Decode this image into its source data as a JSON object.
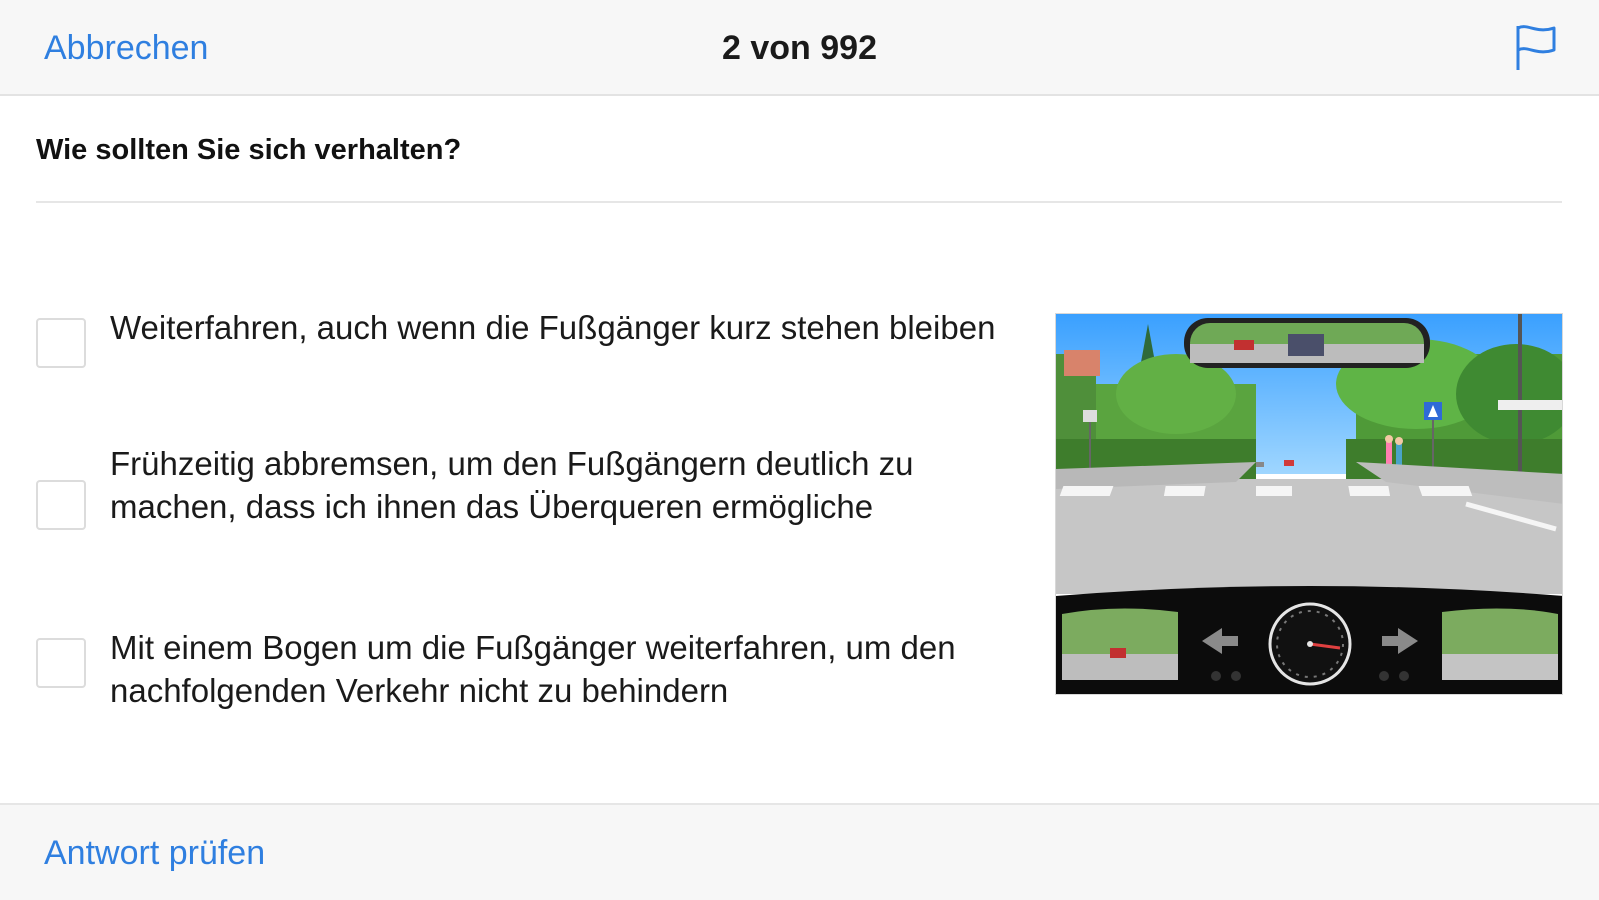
{
  "header": {
    "cancel_label": "Abbrechen",
    "counter": "2 von 992",
    "flag_icon": "flag-icon"
  },
  "question": {
    "text": "Wie sollten Sie sich verhalten?"
  },
  "options": [
    {
      "text": "Weiterfahren, auch wenn die Fußgänger kurz stehen bleiben",
      "checked": false
    },
    {
      "text": "Frühzeitig abbremsen, um den Fußgängern deutlich zu machen, dass ich ihnen das Überqueren ermögliche",
      "checked": false
    },
    {
      "text": "Mit einem Bogen um die Fußgänger weiterfahren, um den nachfolgenden Verkehr nicht zu behindern",
      "checked": false
    }
  ],
  "footer": {
    "check_label": "Antwort prüfen"
  },
  "colors": {
    "accent": "#2f7fe0",
    "bar_background": "#f7f7f7"
  }
}
